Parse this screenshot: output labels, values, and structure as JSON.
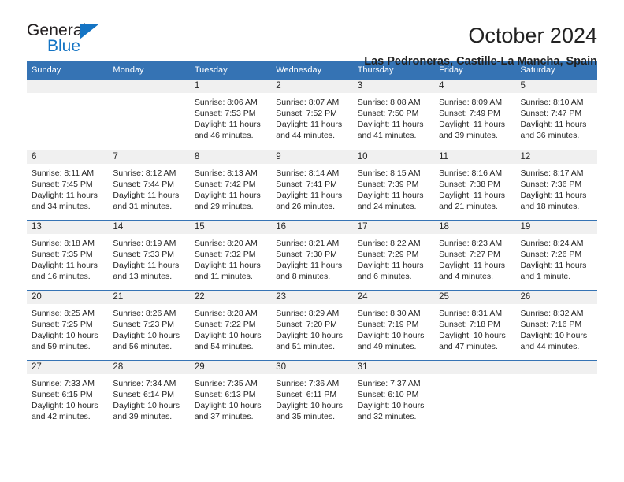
{
  "logo": {
    "text_top": "General",
    "text_bottom": "Blue",
    "triangle_color": "#1474c4"
  },
  "header": {
    "title": "October 2024",
    "subtitle": "Las Pedroneras, Castille-La Mancha, Spain"
  },
  "theme": {
    "header_blue": "#3573b4",
    "day_band_gray": "#f0f0f0",
    "text_color": "#262626"
  },
  "calendar": {
    "day_headers": [
      "Sunday",
      "Monday",
      "Tuesday",
      "Wednesday",
      "Thursday",
      "Friday",
      "Saturday"
    ],
    "weeks": [
      [
        {
          "empty": true
        },
        {
          "empty": true
        },
        {
          "day": "1",
          "sunrise": "Sunrise: 8:06 AM",
          "sunset": "Sunset: 7:53 PM",
          "daylight": "Daylight: 11 hours and 46 minutes."
        },
        {
          "day": "2",
          "sunrise": "Sunrise: 8:07 AM",
          "sunset": "Sunset: 7:52 PM",
          "daylight": "Daylight: 11 hours and 44 minutes."
        },
        {
          "day": "3",
          "sunrise": "Sunrise: 8:08 AM",
          "sunset": "Sunset: 7:50 PM",
          "daylight": "Daylight: 11 hours and 41 minutes."
        },
        {
          "day": "4",
          "sunrise": "Sunrise: 8:09 AM",
          "sunset": "Sunset: 7:49 PM",
          "daylight": "Daylight: 11 hours and 39 minutes."
        },
        {
          "day": "5",
          "sunrise": "Sunrise: 8:10 AM",
          "sunset": "Sunset: 7:47 PM",
          "daylight": "Daylight: 11 hours and 36 minutes."
        }
      ],
      [
        {
          "day": "6",
          "sunrise": "Sunrise: 8:11 AM",
          "sunset": "Sunset: 7:45 PM",
          "daylight": "Daylight: 11 hours and 34 minutes."
        },
        {
          "day": "7",
          "sunrise": "Sunrise: 8:12 AM",
          "sunset": "Sunset: 7:44 PM",
          "daylight": "Daylight: 11 hours and 31 minutes."
        },
        {
          "day": "8",
          "sunrise": "Sunrise: 8:13 AM",
          "sunset": "Sunset: 7:42 PM",
          "daylight": "Daylight: 11 hours and 29 minutes."
        },
        {
          "day": "9",
          "sunrise": "Sunrise: 8:14 AM",
          "sunset": "Sunset: 7:41 PM",
          "daylight": "Daylight: 11 hours and 26 minutes."
        },
        {
          "day": "10",
          "sunrise": "Sunrise: 8:15 AM",
          "sunset": "Sunset: 7:39 PM",
          "daylight": "Daylight: 11 hours and 24 minutes."
        },
        {
          "day": "11",
          "sunrise": "Sunrise: 8:16 AM",
          "sunset": "Sunset: 7:38 PM",
          "daylight": "Daylight: 11 hours and 21 minutes."
        },
        {
          "day": "12",
          "sunrise": "Sunrise: 8:17 AM",
          "sunset": "Sunset: 7:36 PM",
          "daylight": "Daylight: 11 hours and 18 minutes."
        }
      ],
      [
        {
          "day": "13",
          "sunrise": "Sunrise: 8:18 AM",
          "sunset": "Sunset: 7:35 PM",
          "daylight": "Daylight: 11 hours and 16 minutes."
        },
        {
          "day": "14",
          "sunrise": "Sunrise: 8:19 AM",
          "sunset": "Sunset: 7:33 PM",
          "daylight": "Daylight: 11 hours and 13 minutes."
        },
        {
          "day": "15",
          "sunrise": "Sunrise: 8:20 AM",
          "sunset": "Sunset: 7:32 PM",
          "daylight": "Daylight: 11 hours and 11 minutes."
        },
        {
          "day": "16",
          "sunrise": "Sunrise: 8:21 AM",
          "sunset": "Sunset: 7:30 PM",
          "daylight": "Daylight: 11 hours and 8 minutes."
        },
        {
          "day": "17",
          "sunrise": "Sunrise: 8:22 AM",
          "sunset": "Sunset: 7:29 PM",
          "daylight": "Daylight: 11 hours and 6 minutes."
        },
        {
          "day": "18",
          "sunrise": "Sunrise: 8:23 AM",
          "sunset": "Sunset: 7:27 PM",
          "daylight": "Daylight: 11 hours and 4 minutes."
        },
        {
          "day": "19",
          "sunrise": "Sunrise: 8:24 AM",
          "sunset": "Sunset: 7:26 PM",
          "daylight": "Daylight: 11 hours and 1 minute."
        }
      ],
      [
        {
          "day": "20",
          "sunrise": "Sunrise: 8:25 AM",
          "sunset": "Sunset: 7:25 PM",
          "daylight": "Daylight: 10 hours and 59 minutes."
        },
        {
          "day": "21",
          "sunrise": "Sunrise: 8:26 AM",
          "sunset": "Sunset: 7:23 PM",
          "daylight": "Daylight: 10 hours and 56 minutes."
        },
        {
          "day": "22",
          "sunrise": "Sunrise: 8:28 AM",
          "sunset": "Sunset: 7:22 PM",
          "daylight": "Daylight: 10 hours and 54 minutes."
        },
        {
          "day": "23",
          "sunrise": "Sunrise: 8:29 AM",
          "sunset": "Sunset: 7:20 PM",
          "daylight": "Daylight: 10 hours and 51 minutes."
        },
        {
          "day": "24",
          "sunrise": "Sunrise: 8:30 AM",
          "sunset": "Sunset: 7:19 PM",
          "daylight": "Daylight: 10 hours and 49 minutes."
        },
        {
          "day": "25",
          "sunrise": "Sunrise: 8:31 AM",
          "sunset": "Sunset: 7:18 PM",
          "daylight": "Daylight: 10 hours and 47 minutes."
        },
        {
          "day": "26",
          "sunrise": "Sunrise: 8:32 AM",
          "sunset": "Sunset: 7:16 PM",
          "daylight": "Daylight: 10 hours and 44 minutes."
        }
      ],
      [
        {
          "day": "27",
          "sunrise": "Sunrise: 7:33 AM",
          "sunset": "Sunset: 6:15 PM",
          "daylight": "Daylight: 10 hours and 42 minutes."
        },
        {
          "day": "28",
          "sunrise": "Sunrise: 7:34 AM",
          "sunset": "Sunset: 6:14 PM",
          "daylight": "Daylight: 10 hours and 39 minutes."
        },
        {
          "day": "29",
          "sunrise": "Sunrise: 7:35 AM",
          "sunset": "Sunset: 6:13 PM",
          "daylight": "Daylight: 10 hours and 37 minutes."
        },
        {
          "day": "30",
          "sunrise": "Sunrise: 7:36 AM",
          "sunset": "Sunset: 6:11 PM",
          "daylight": "Daylight: 10 hours and 35 minutes."
        },
        {
          "day": "31",
          "sunrise": "Sunrise: 7:37 AM",
          "sunset": "Sunset: 6:10 PM",
          "daylight": "Daylight: 10 hours and 32 minutes."
        },
        {
          "empty": true
        },
        {
          "empty": true
        }
      ]
    ]
  }
}
